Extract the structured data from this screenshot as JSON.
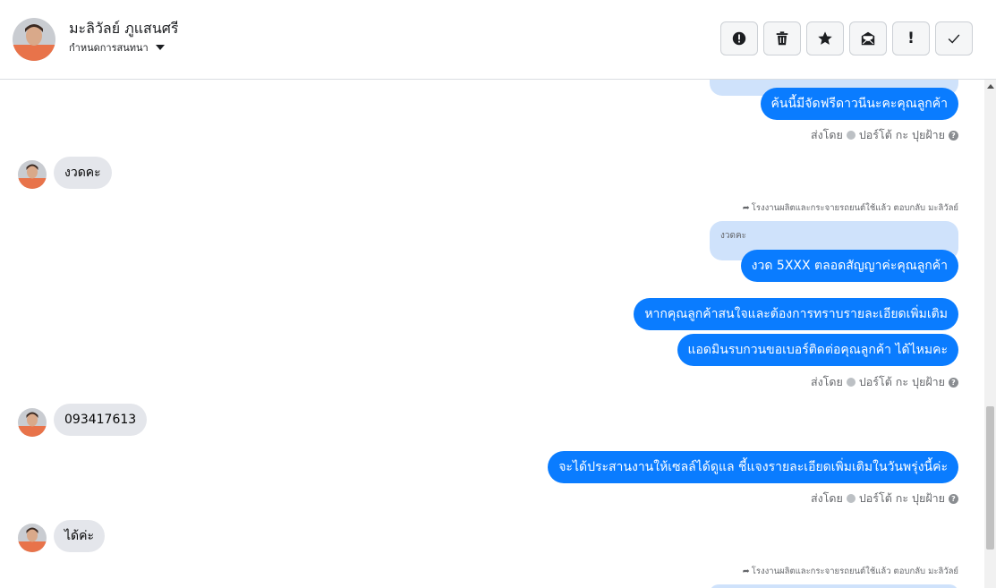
{
  "header": {
    "contact_name": "มะลิวัลย์ ภูแสนศรี",
    "conversation_settings": "กำหนดการสนทนา",
    "actions": [
      {
        "name": "spam-button",
        "icon": "alert-circle-icon"
      },
      {
        "name": "delete-button",
        "icon": "trash-icon"
      },
      {
        "name": "star-button",
        "icon": "star-icon"
      },
      {
        "name": "mark-unread-button",
        "icon": "envelope-open-icon"
      },
      {
        "name": "important-button",
        "icon": "exclamation-icon",
        "glyph": "!"
      },
      {
        "name": "mark-done-button",
        "icon": "check-icon"
      }
    ]
  },
  "messages": {
    "m1": "ค้นนี้มีจัดฟรีดาวนีนะคะคุณลูกค้า",
    "m2": "งวดคะ",
    "m3_reply_note": "โรงงานผลิตและกระจายรถยนต์ใช้แล้ว ตอบกลับ มะลิวัลย์",
    "m3_quote": "งวดคะ",
    "m3": "งวด 5XXX ตลอดสัญญาค่ะคุณลูกค้า",
    "m4": "หากคุณลูกค้าสนใจและต้องการทราบรายละเอียดเพิ่มเติม",
    "m5": "แอดมินรบกวนขอเบอร์ติดต่อคุณลูกค้า ได้ไหมคะ",
    "m6": "093417613",
    "m7": "จะได้ประสานงานให้เซลล์ได้ดูแล ชี้แจงรายละเอียดเพิ่มเติมในวันพรุ่งนี้ค่ะ",
    "m8": "ได้ค่ะ",
    "m9_reply_note": "โรงงานผลิตและกระจายรถยนต์ใช้แล้ว ตอบกลับ มะลิวัลย์"
  },
  "sender_info": {
    "prefix": "ส่งโดย",
    "name": "ปอร์โต้ กะ ปุยฝ้าย",
    "help": "?"
  },
  "colors": {
    "outgoing": "#0a7cff",
    "incoming": "#e4e6eb",
    "quote": "#cfe2fb"
  }
}
